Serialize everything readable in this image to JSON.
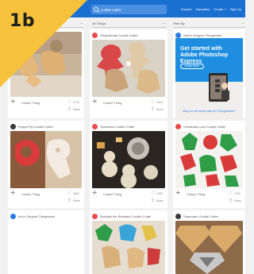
{
  "badge": {
    "label": "1b"
  },
  "header": {
    "search_query": "cookie cutter",
    "nav": [
      "Explore",
      "Education",
      "Create +",
      "Sign Up"
    ]
  },
  "filters": [
    {
      "label": "All Things"
    },
    {
      "label": "Filter By"
    }
  ],
  "cards": [
    {
      "title": "",
      "collect": "Collect Thing",
      "likes": "2712",
      "share": "Share"
    },
    {
      "title": "Gingerbread Cookie Cutter",
      "collect": "Collect Thing",
      "likes": "2623",
      "share": "Share"
    },
    {
      "title": "Add to Support Thingiverse"
    },
    {
      "title": "Peppa Pig Cookie Cutter",
      "collect": "Collect Thing",
      "likes": "3650",
      "share": "Share"
    },
    {
      "title": "Snowman Cookie Cutter",
      "collect": "Collect Thing",
      "likes": "4250",
      "share": "Share"
    },
    {
      "title": "Christmas Lock Cookie Cutter",
      "collect": "Collect Thing",
      "likes": "1150",
      "share": "Share"
    },
    {
      "title": "Ad to Support Thingiverse"
    },
    {
      "title": "Rudolph the Reindeer Cookie Cutter"
    },
    {
      "title": "Superman Cookie Cutter"
    }
  ],
  "ad": {
    "headline": "Get started with Adobe Photoshop Express",
    "button": "Learn More",
    "link": "Why to we show ads on Thingiverse?"
  },
  "colors": {
    "header_blue": "#1b6fd1",
    "badge_yellow": "#f6c23c",
    "avatar_red": "#e84d4d"
  }
}
